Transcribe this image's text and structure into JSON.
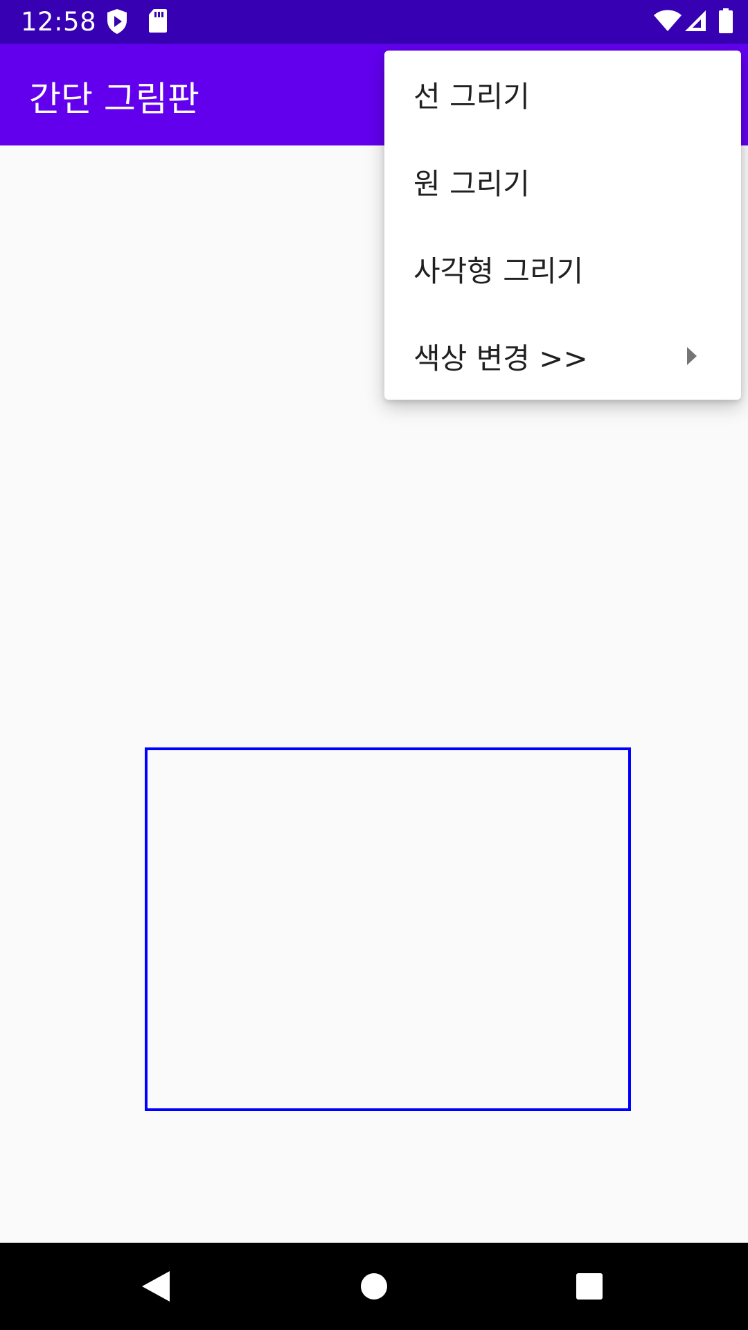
{
  "status_bar": {
    "time": "12:58",
    "left_icons": [
      "play-protect-icon",
      "sd-card-icon"
    ],
    "right_icons": [
      "wifi-icon",
      "signal-icon",
      "battery-icon"
    ]
  },
  "app_bar": {
    "title": "간단 그림판"
  },
  "menu": {
    "items": [
      {
        "label": "선 그리기"
      },
      {
        "label": "원 그리기"
      },
      {
        "label": "사각형 그리기"
      },
      {
        "label": "색상 변경 >>",
        "has_submenu": true
      }
    ]
  },
  "canvas": {
    "shape": "rectangle",
    "stroke_color": "#0000ff"
  },
  "colors": {
    "status_bar": "#3700b3",
    "app_bar": "#6200ee",
    "background": "#fafafa"
  },
  "nav_bar": {
    "buttons": [
      "back-icon",
      "home-icon",
      "recents-icon"
    ]
  }
}
